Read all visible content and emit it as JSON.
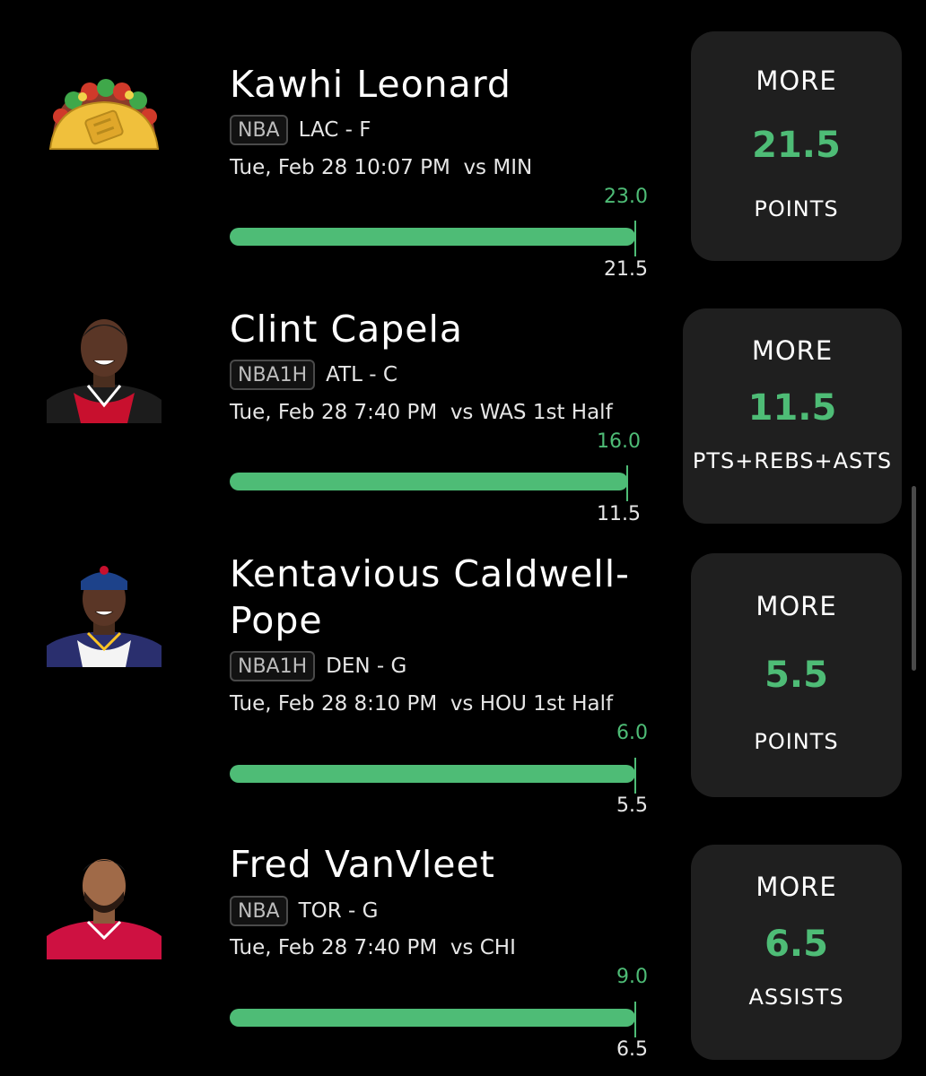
{
  "colors": {
    "accent": "#4ebc76",
    "card_bg": "#1f1f1f",
    "background": "#000000"
  },
  "picks": [
    {
      "player": "Kawhi Leonard",
      "league": "NBA",
      "team_pos": "LAC - F",
      "game": "Tue, Feb 28 10:07 PM  vs MIN",
      "actual": "23.0",
      "line": "21.5",
      "direction": "MORE",
      "stat": "POINTS",
      "avatar_icon": "taco-icon"
    },
    {
      "player": "Clint Capela",
      "league": "NBA1H",
      "team_pos": "ATL - C",
      "game": "Tue, Feb 28 7:40 PM  vs WAS 1st Half",
      "actual": "16.0",
      "line": "11.5",
      "direction": "MORE",
      "stat": "PTS+REBS+ASTS",
      "avatar_icon": "player-headshot"
    },
    {
      "player": "Kentavious Caldwell-Pope",
      "league": "NBA1H",
      "team_pos": "DEN - G",
      "game": "Tue, Feb 28 8:10 PM  vs HOU 1st Half",
      "actual": "6.0",
      "line": "5.5",
      "direction": "MORE",
      "stat": "POINTS",
      "avatar_icon": "player-headshot"
    },
    {
      "player": "Fred VanVleet",
      "league": "NBA",
      "team_pos": "TOR - G",
      "game": "Tue, Feb 28 7:40 PM  vs CHI",
      "actual": "9.0",
      "line": "6.5",
      "direction": "MORE",
      "stat": "ASSISTS",
      "avatar_icon": "player-headshot"
    }
  ]
}
